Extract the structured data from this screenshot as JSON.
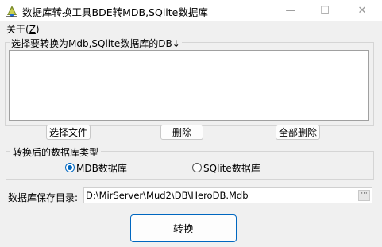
{
  "window": {
    "title": "数据库转换工具BDE转MDB,SQlite数据库",
    "minimize_glyph": "—",
    "maximize_glyph": "☐",
    "close_glyph": "✕",
    "icon": "app-icon"
  },
  "menu": {
    "about_label": "关于(",
    "about_accel": "Z",
    "about_end": ")"
  },
  "source_group": {
    "label": "选择要转换为Mdb,SQlite数据库的DB↓",
    "items": []
  },
  "buttons": {
    "select_file": "选择文件",
    "delete": "删除",
    "delete_all": "全部删除",
    "convert": "转换"
  },
  "db_type_group": {
    "label": "转换后的数据库类型",
    "options": [
      {
        "label": "MDB数据库",
        "checked": true
      },
      {
        "label": "SQlite数据库",
        "checked": false
      }
    ]
  },
  "save_dir": {
    "label": "数据库保存目录:",
    "value": "D:\\MirServer\\Mud2\\DB\\HeroDB.Mdb",
    "browse_label": "···"
  },
  "colors": {
    "accent": "#0067c0",
    "window_bg": "#f0f0f0",
    "titlebar_bg": "#ffffff"
  }
}
